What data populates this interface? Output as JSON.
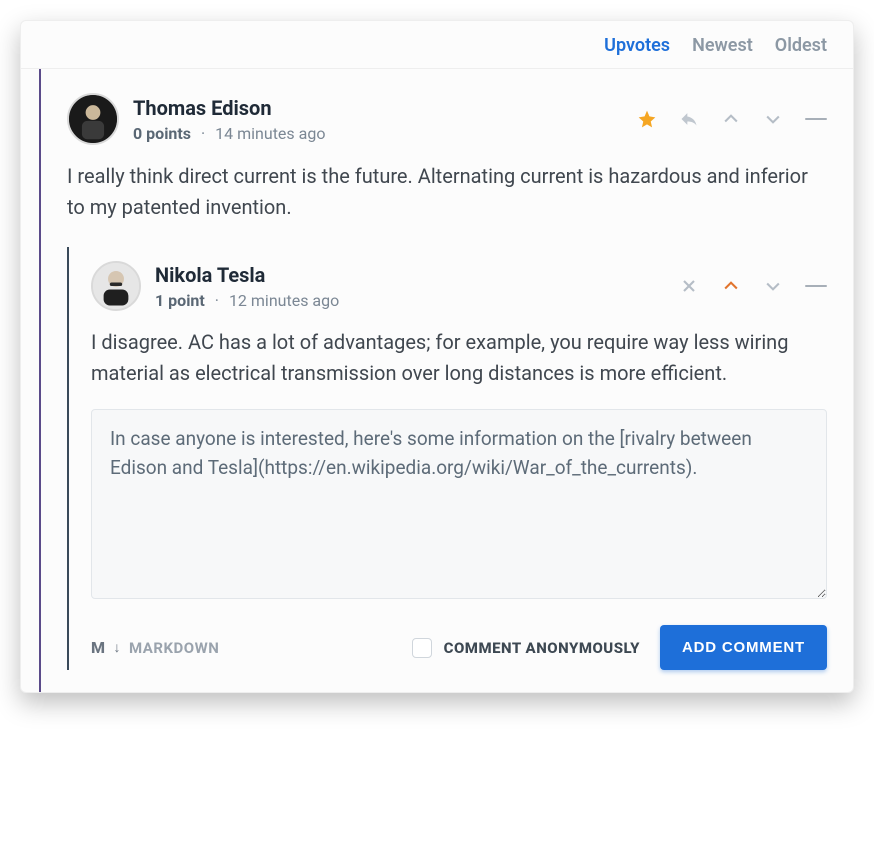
{
  "sort": {
    "options": [
      "Upvotes",
      "Newest",
      "Oldest"
    ],
    "active": "Upvotes"
  },
  "comment1": {
    "author": "Thomas Edison",
    "points": "0 points",
    "time": "14 minutes ago",
    "body": "I really think direct current is the future. Alternating current is hazardous and inferior to my patented invention.",
    "starred": true
  },
  "comment2": {
    "author": "Nikola Tesla",
    "points": "1 point",
    "time": "12 minutes ago",
    "body": "I disagree. AC has a lot of advantages; for example, you require way less wiring material as electrical transmission over long distances is more efficient.",
    "upvoted": true
  },
  "editor": {
    "value": "In case anyone is interested, here's some information on the [rivalry between Edison and Tesla](https://en.wikipedia.org/wiki/War_of_the_currents)."
  },
  "footer": {
    "markdown_label": "MARKDOWN",
    "markdown_short": "M",
    "anon_label": "COMMENT ANONYMOUSLY",
    "submit_label": "ADD COMMENT"
  }
}
